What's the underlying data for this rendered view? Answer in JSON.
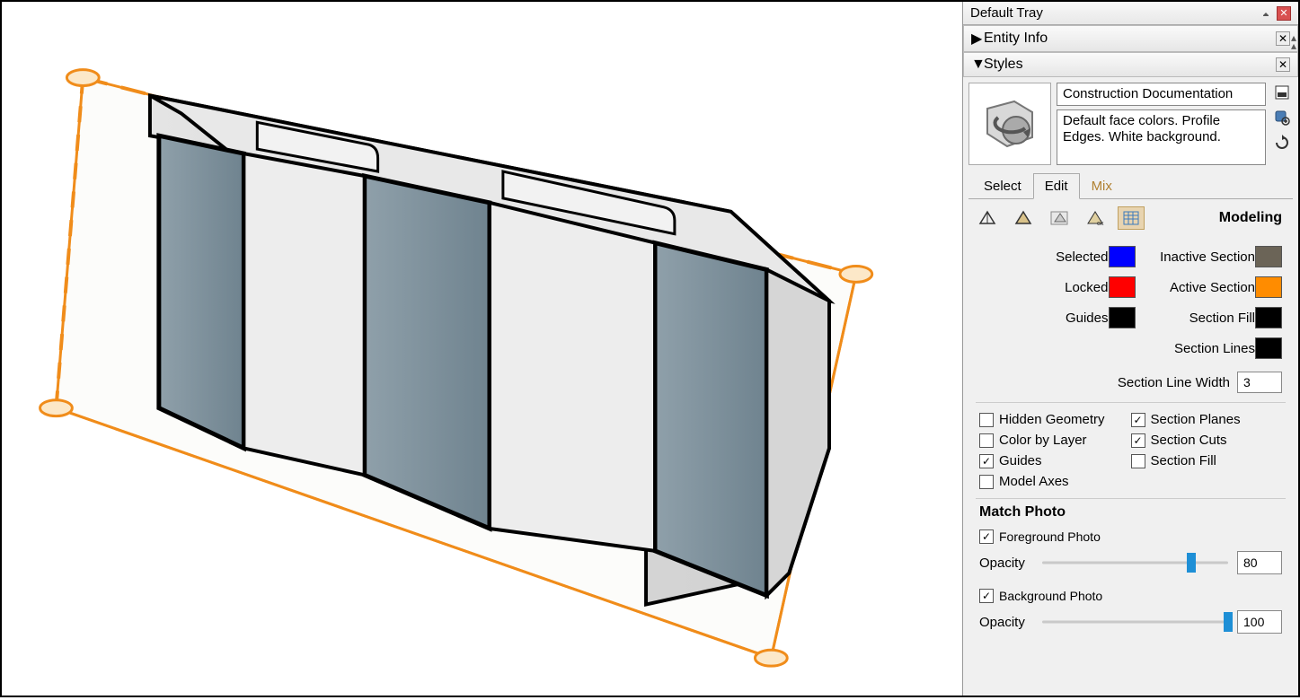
{
  "tray": {
    "title": "Default Tray"
  },
  "panels": {
    "entityInfo": {
      "title": "Entity Info",
      "expanded": false
    },
    "styles": {
      "title": "Styles",
      "expanded": true
    }
  },
  "style": {
    "name": "Construction Documentation",
    "desc": "Default face colors. Profile Edges. White background."
  },
  "tabs": {
    "select": "Select",
    "edit": "Edit",
    "mix": "Mix",
    "active": "edit"
  },
  "modeling": {
    "label": "Modeling",
    "colors": {
      "selected": {
        "label": "Selected",
        "value": "#0000ff"
      },
      "locked": {
        "label": "Locked",
        "value": "#ff0000"
      },
      "guides": {
        "label": "Guides",
        "value": "#000000"
      },
      "inactiveSection": {
        "label": "Inactive Section",
        "value": "#6b6457"
      },
      "activeSection": {
        "label": "Active Section",
        "value": "#ff8c00"
      },
      "sectionFill": {
        "label": "Section Fill",
        "value": "#000000"
      },
      "sectionLines": {
        "label": "Section Lines",
        "value": "#000000"
      }
    },
    "sectionLineWidth": {
      "label": "Section Line Width",
      "value": "3"
    },
    "checks": {
      "hiddenGeometry": {
        "label": "Hidden Geometry",
        "checked": false
      },
      "colorByLayer": {
        "label": "Color by Layer",
        "checked": false
      },
      "guides": {
        "label": "Guides",
        "checked": true
      },
      "modelAxes": {
        "label": "Model Axes",
        "checked": false
      },
      "sectionPlanes": {
        "label": "Section Planes",
        "checked": true
      },
      "sectionCuts": {
        "label": "Section Cuts",
        "checked": true
      },
      "sectionFill": {
        "label": "Section Fill",
        "checked": false
      }
    }
  },
  "matchPhoto": {
    "heading": "Match Photo",
    "foreground": {
      "label": "Foreground Photo",
      "checked": true,
      "opacityLabel": "Opacity",
      "opacity": "80"
    },
    "background": {
      "label": "Background Photo",
      "checked": true,
      "opacityLabel": "Opacity",
      "opacity": "100"
    }
  }
}
